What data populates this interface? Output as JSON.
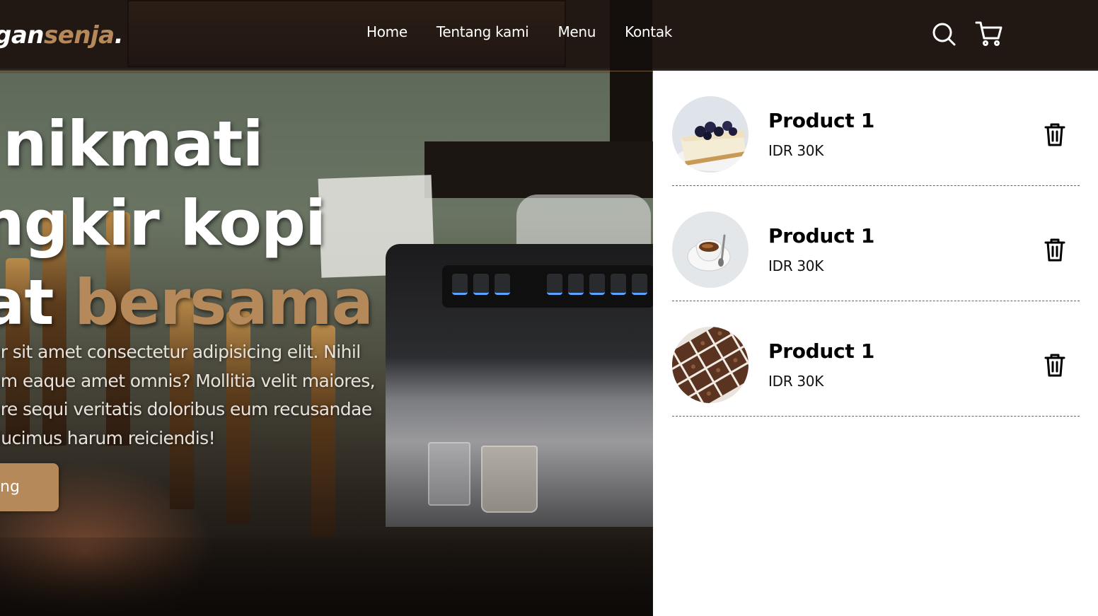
{
  "brand": {
    "prefix": "gan",
    "accent": "senja",
    "suffix": ".",
    "accent_color": "#b6895b"
  },
  "nav": {
    "links": [
      "Home",
      "Tentang kami",
      "Menu",
      "Kontak"
    ],
    "icons": [
      "search-icon",
      "shopping-cart-icon"
    ]
  },
  "hero": {
    "title_line1": "nikmati",
    "title_line2": "ngkir kopi",
    "title_line3_start": "at",
    "title_line3_accent": "bersama",
    "description_lines": [
      "or sit amet consectetur adipisicing elit. Nihil",
      "am eaque amet omnis? Mollitia velit maiores,",
      "ore sequi veritatis doloribus eum recusandae",
      "ducimus harum reiciendis!"
    ],
    "cta_label": "ng"
  },
  "cart": {
    "items": [
      {
        "name": "Product 1",
        "price": "IDR 30K",
        "image": "blueberry-cheesecake"
      },
      {
        "name": "Product 1",
        "price": "IDR 30K",
        "image": "espresso-cup"
      },
      {
        "name": "Product 1",
        "price": "IDR 30K",
        "image": "brownies"
      }
    ]
  },
  "colors": {
    "accent": "#b6895b",
    "cart_bg": "#ffffff",
    "text_dark": "#000000"
  }
}
